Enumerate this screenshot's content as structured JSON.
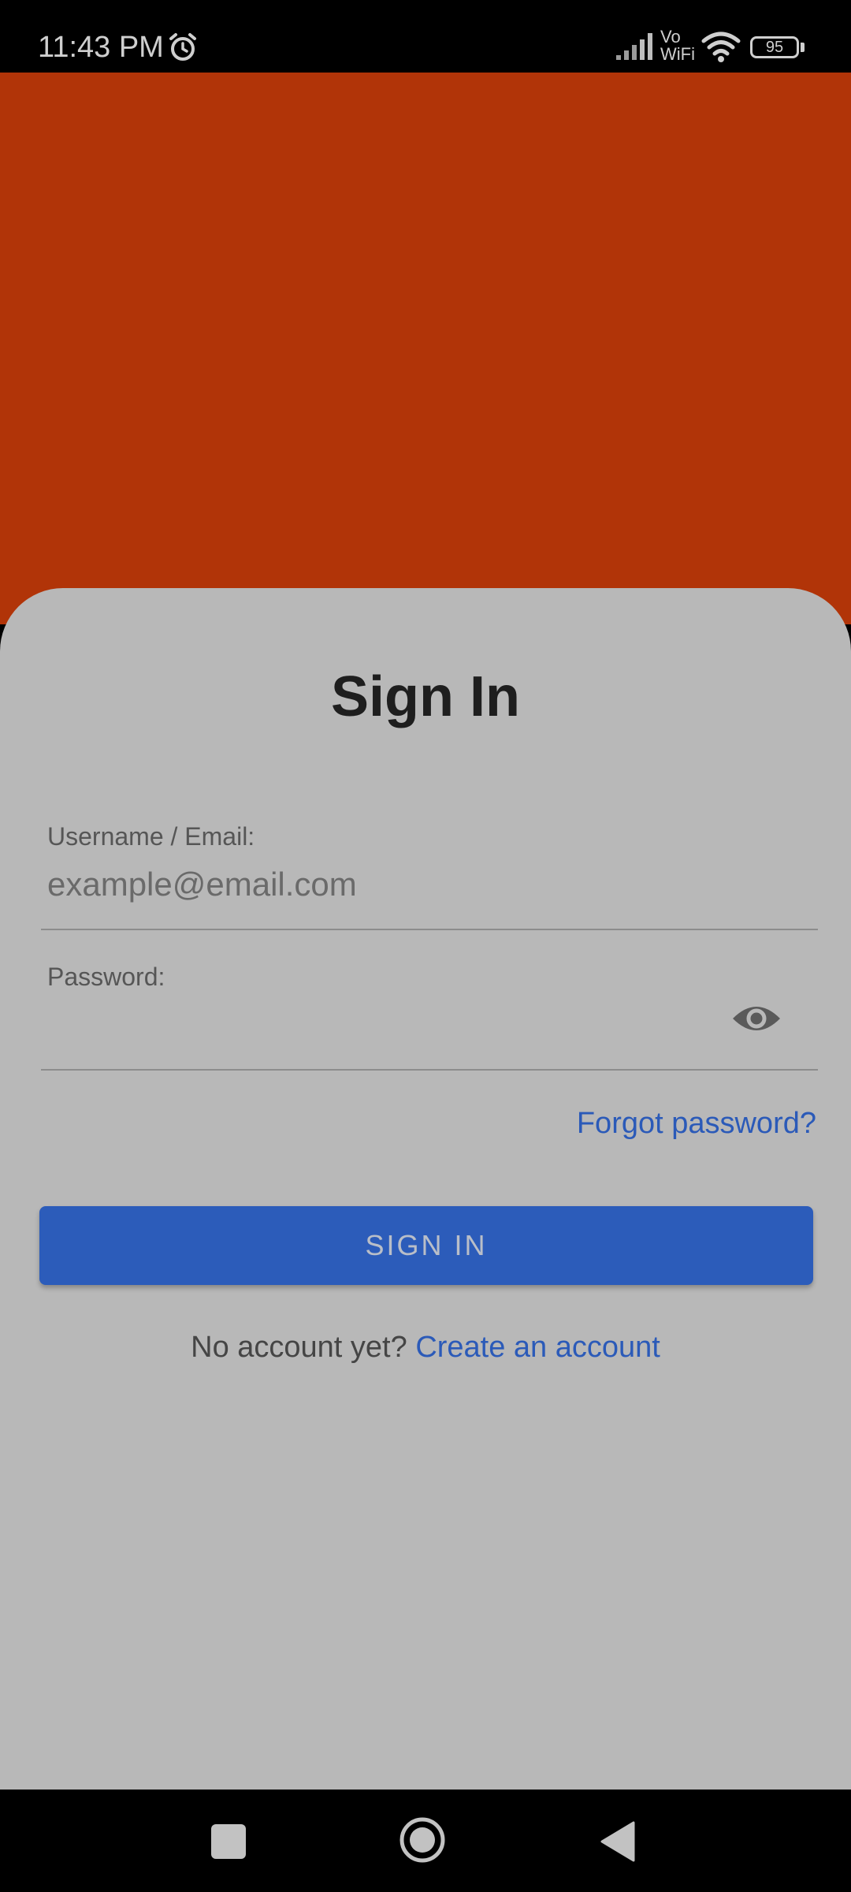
{
  "status_bar": {
    "time": "11:43 PM",
    "network_label_top": "Vo",
    "network_label_bottom": "WiFi",
    "battery_level": "95",
    "icons": [
      "alarm-icon",
      "signal-icon",
      "wifi-icon",
      "battery-icon"
    ]
  },
  "colors": {
    "hero_background": "#b13408",
    "sheet_background": "#b8b8b8",
    "primary_button": "#2c5cba",
    "link": "#2b5ab8"
  },
  "form": {
    "title": "Sign In",
    "username_label": "Username / Email:",
    "username_placeholder": "example@email.com",
    "username_value": "",
    "password_label": "Password:",
    "password_value": "",
    "password_toggle_icon": "eye-icon",
    "forgot_password": "Forgot password?",
    "submit_label": "SIGN IN",
    "signup_prompt": "No account yet?",
    "signup_link": "Create an account"
  },
  "nav_bar": {
    "icons": [
      "recents-icon",
      "home-icon",
      "back-icon"
    ]
  }
}
